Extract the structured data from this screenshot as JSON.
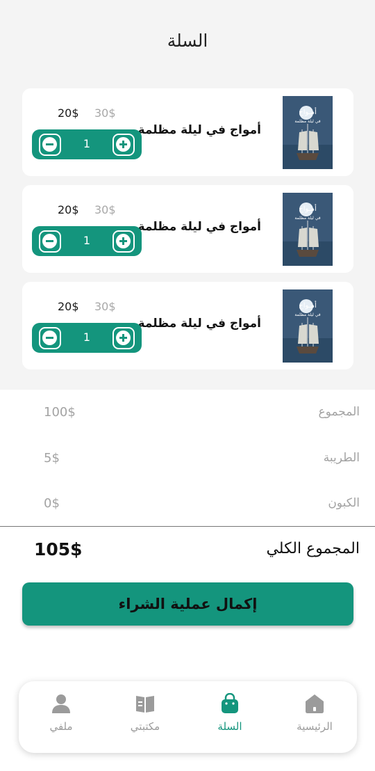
{
  "header": {
    "title": "السلة"
  },
  "cart": {
    "items": [
      {
        "title": "أمواج في ليلة مظلمة",
        "old_price": "30$",
        "new_price": "20$",
        "quantity": "1",
        "cover_title": "أمـواج",
        "cover_subtitle": "في ليلة مظلمة"
      },
      {
        "title": "أمواج في ليلة مظلمة",
        "old_price": "30$",
        "new_price": "20$",
        "quantity": "1",
        "cover_title": "أمـواج",
        "cover_subtitle": "في ليلة مظلمة"
      },
      {
        "title": "أمواج في ليلة مظلمة",
        "old_price": "30$",
        "new_price": "20$",
        "quantity": "1",
        "cover_title": "أمـواج",
        "cover_subtitle": "في ليلة مظلمة"
      }
    ]
  },
  "summary": {
    "subtotal_label": "المجموع",
    "subtotal_value": "100$",
    "tax_label": "الطريبة",
    "tax_value": "5$",
    "coupon_label": "الكبون",
    "coupon_value": "0$",
    "total_label": "المجموع الكلي",
    "total_value": "105$"
  },
  "checkout": {
    "label": "إكمال عملية الشراء"
  },
  "nav": {
    "profile": "ملفي",
    "library": "مكتبتي",
    "cart": "السلة",
    "home": "الرئيسية",
    "active": "cart"
  },
  "colors": {
    "accent": "#14957d",
    "background_top": "#f4f4f4",
    "muted_text": "#a3a3a3"
  },
  "icons": [
    "minus-icon",
    "plus-icon",
    "user-icon",
    "book-icon",
    "shopping-bag-icon",
    "home-icon"
  ]
}
